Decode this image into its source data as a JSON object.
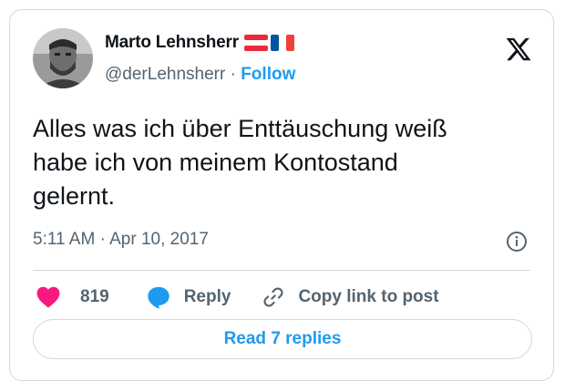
{
  "author": {
    "display_name": "Marto Lehnsherr",
    "handle": "@derLehnsherr",
    "separator": "·",
    "follow_label": "Follow",
    "flags": [
      "austria-flag",
      "france-flag"
    ]
  },
  "tweet": {
    "text": "Alles was ich über Enttäuschung weiß\nhabe ich von meinem Kontostand\ngelernt.",
    "timestamp": "5:11 AM · Apr 10, 2017"
  },
  "actions": {
    "like_count": "819",
    "reply_label": "Reply",
    "copy_link_label": "Copy link to post"
  },
  "read_replies_label": "Read 7 replies",
  "colors": {
    "accent": "#1d9bf0",
    "like": "#f91880",
    "text": "#0f1419",
    "muted": "#536471",
    "border": "#cfd9de"
  },
  "icons": [
    "x-logo-icon",
    "info-icon",
    "heart-icon",
    "reply-bubble-icon",
    "link-icon"
  ]
}
